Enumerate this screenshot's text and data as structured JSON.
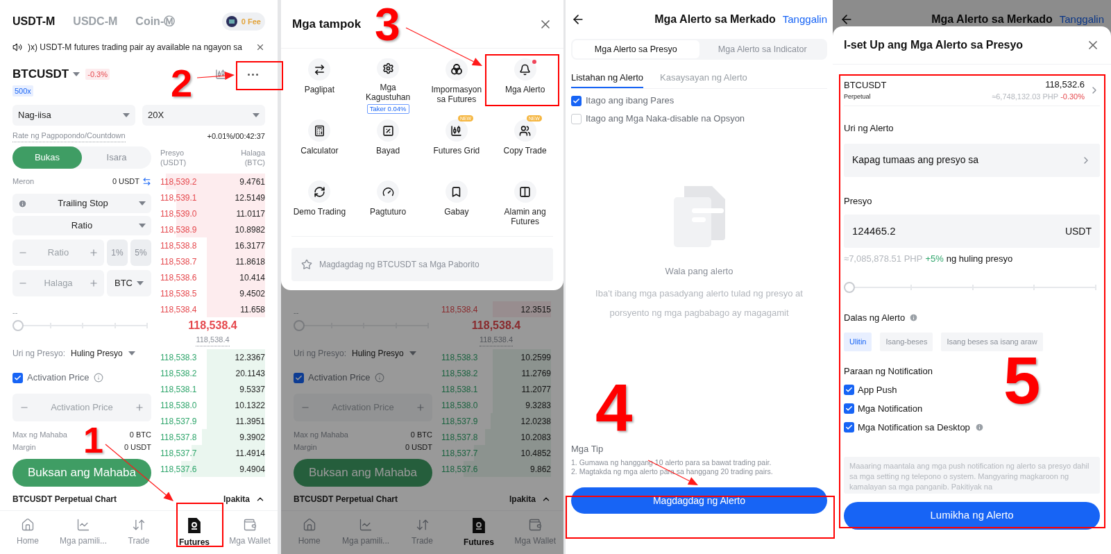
{
  "steps": [
    "1",
    "2",
    "3",
    "4",
    "5"
  ],
  "futures": {
    "market_tabs": [
      {
        "label": "USDT-M",
        "selected": true
      },
      {
        "label": "USDC-M",
        "selected": false
      },
      {
        "label": "Coin-Ⓜ",
        "selected": false
      }
    ],
    "fee_badge": "0 Fee",
    "announcement": ")x) USDT-M futures trading pair ay available na ngayon sa",
    "symbol": "BTCUSDT",
    "change": "-0.3%",
    "leverage_badge": "500x",
    "margin_mode": "Nag-iisa",
    "leverage": "20X",
    "funding_label": "Rate ng Pagpopondo/Countdown",
    "funding_value": "+0.01%/00:42:37",
    "order": {
      "side_tabs": [
        {
          "label": "Bukas",
          "selected": true
        },
        {
          "label": "Isara",
          "selected": false
        }
      ],
      "available_label": "Meron",
      "available_value": "0 USDT",
      "order_type": "Trailing Stop",
      "mode": "Ratio",
      "ratio_placeholder": "Ratio",
      "ratio_presets": [
        "1%",
        "5%"
      ],
      "amount_placeholder": "Halaga",
      "amount_unit": "BTC"
    },
    "lower": {
      "dash": "--",
      "slider": {
        "level": 0
      },
      "price_type_label": "Uri ng Presyo:",
      "price_type": "Huling Presyo",
      "activation": {
        "label": "Activation Price",
        "checked": true,
        "placeholder": "Activation Price"
      },
      "max_label": "Max ng Mahaba",
      "max_value": "0 BTC",
      "margin_label": "Margin",
      "margin_value": "0 USDT",
      "open_button": "Buksan ang Mahaba"
    },
    "book": {
      "price_header": "Presyo (USDT)",
      "amount_header": "Halaga (BTC)",
      "asks": [
        {
          "price": "118,539.2",
          "amount": "9.4761"
        },
        {
          "price": "118,539.1",
          "amount": "12.5149"
        },
        {
          "price": "118,539.0",
          "amount": "11.0117"
        },
        {
          "price": "118,538.9",
          "amount": "10.8982"
        },
        {
          "price": "118,538.8",
          "amount": "16.3177"
        },
        {
          "price": "118,538.7",
          "amount": "11.8618"
        },
        {
          "price": "118,538.6",
          "amount": "10.414"
        },
        {
          "price": "118,538.5",
          "amount": "9.4502"
        },
        {
          "price": "118,538.4",
          "amount": "11.658"
        }
      ],
      "mid_price": "118,538.4",
      "mark_price": "118,538.4",
      "bids": [
        {
          "price": "118,538.3",
          "amount": "12.3367"
        },
        {
          "price": "118,538.2",
          "amount": "20.1143"
        },
        {
          "price": "118,538.1",
          "amount": "9.5337"
        },
        {
          "price": "118,538.0",
          "amount": "10.1322"
        },
        {
          "price": "118,537.9",
          "amount": "11.3951"
        },
        {
          "price": "118,537.8",
          "amount": "9.3902"
        },
        {
          "price": "118,537.7",
          "amount": "11.4914"
        },
        {
          "price": "118,537.6",
          "amount": "9.4904"
        }
      ]
    },
    "chart_bar": {
      "title": "BTCUSDT Perpetual Chart",
      "toggle": "Ipakita"
    },
    "nav": [
      {
        "label": "Home",
        "selected": false
      },
      {
        "label": "Mga pamili...",
        "selected": false
      },
      {
        "label": "Trade",
        "selected": false
      },
      {
        "label": "Futures",
        "selected": true
      },
      {
        "label": "Mga Wallet",
        "selected": false
      }
    ]
  },
  "features_screen": {
    "sheet": {
      "title": "Mga tampok",
      "items": [
        {
          "label": "Paglipat",
          "notification": false
        },
        {
          "label": "Mga Kagustuhan",
          "notification": false,
          "tag": "Taker 0.04%"
        },
        {
          "label": "Impormasyon sa Futures",
          "notification": false
        },
        {
          "label": "Mga Alerto",
          "notification": true
        },
        {
          "label": "Calculator",
          "notification": false
        },
        {
          "label": "Bayad",
          "notification": false
        },
        {
          "label": "Futures Grid",
          "notification": false,
          "badge": "NEW"
        },
        {
          "label": "Copy Trade",
          "notification": false,
          "badge": "NEW"
        },
        {
          "label": "Demo Trading",
          "notification": false
        },
        {
          "label": "Pagtuturo",
          "notification": false
        },
        {
          "label": "Gabay",
          "notification": false
        },
        {
          "label": "Alamin ang Futures",
          "notification": false
        }
      ],
      "favorite": "Magdagdag ng BTCUSDT sa Mga Paborito"
    },
    "background": {
      "lower": {
        "dash": "--",
        "slider": {
          "level": 0
        },
        "price_type_label": "Uri ng Presyo:",
        "price_type": "Huling Presyo",
        "activation": {
          "label": "Activation Price",
          "checked": true,
          "placeholder": "Activation Price"
        },
        "max_label": "Max ng Mahaba",
        "max_value": "0 BTC",
        "margin_label": "Margin",
        "margin_value": "0 USDT",
        "open_button": "Buksan ang Mahaba"
      },
      "book": {
        "asks": [
          {
            "price": "118,538.4",
            "amount": "12.3515"
          }
        ],
        "mid_price": "118,538.4",
        "mark_price": "118,538.4",
        "bids": [
          {
            "price": "118,538.3",
            "amount": "10.2599"
          },
          {
            "price": "118,538.2",
            "amount": "11.2769"
          },
          {
            "price": "118,538.1",
            "amount": "11.2077"
          },
          {
            "price": "118,538.0",
            "amount": "9.3283"
          },
          {
            "price": "118,537.9",
            "amount": "12.0238"
          },
          {
            "price": "118,537.8",
            "amount": "10.2083"
          },
          {
            "price": "118,537.7",
            "amount": "10.4852"
          },
          {
            "price": "118,537.6",
            "amount": "9.862"
          }
        ]
      },
      "chart_bar": {
        "title": "BTCUSDT Perpetual Chart",
        "toggle": "Ipakita"
      },
      "nav": [
        {
          "label": "Home",
          "selected": false
        },
        {
          "label": "Mga pamili...",
          "selected": false
        },
        {
          "label": "Trade",
          "selected": false
        },
        {
          "label": "Futures",
          "selected": true
        },
        {
          "label": "Mga Wallet",
          "selected": false
        }
      ]
    }
  },
  "alerts_screen": {
    "title": "Mga Alerto sa Merkado",
    "action": "Tanggalin",
    "type_tabs": [
      {
        "label": "Mga Alerto sa Presyo",
        "selected": true
      },
      {
        "label": "Mga Alerto sa Indicator",
        "selected": false
      }
    ],
    "list_tabs": [
      {
        "label": "Listahan ng Alerto",
        "selected": true
      },
      {
        "label": "Kasaysayan ng Alerto",
        "selected": false
      }
    ],
    "filters": [
      {
        "label": "Itago ang ibang Pares",
        "checked": true
      },
      {
        "label": "Itago ang Mga Naka-disable na Opsyon",
        "checked": false
      }
    ],
    "empty_title": "Wala pang alerto",
    "empty_text": "Iba't ibang mga pasadyang alerto tulad ng presyo at porsyento ng mga pagbabago ay magagamit",
    "tips_title": "Mga Tip",
    "tips": [
      "1. Gumawa ng hanggang 10 alerto para sa bawat trading pair.",
      "2. Magtakda ng mga alerto para sa hanggang 20 trading pairs."
    ],
    "add_button": "Magdagdag ng Alerto"
  },
  "setup_screen": {
    "background_title": "Mga Alerto sa Merkado",
    "background_action": "Tanggalin",
    "title": "I-set Up ang Mga Alerto sa Presyo",
    "pair": {
      "symbol": "BTCUSDT",
      "type": "Perpetual",
      "price": "118,532.6",
      "converted": "≈6,748,132.03 PHP",
      "change": "-0.30%"
    },
    "alert_type_label": "Uri ng Alerto",
    "alert_type": "Kapag tumaas ang presyo sa",
    "price_label": "Presyo",
    "price_value": "124465.2",
    "price_unit": "USDT",
    "hint_value": "≈7,085,878.51 PHP",
    "hint_change": "+5%",
    "hint_text": "ng huling presyo",
    "slider": {
      "level": 0
    },
    "frequency_label": "Dalas ng Alerto",
    "frequency": [
      {
        "label": "Ulitin",
        "selected": true
      },
      {
        "label": "Isang-beses",
        "selected": false
      },
      {
        "label": "Isang beses sa isang araw",
        "selected": false
      }
    ],
    "methods_label": "Paraan ng Notification",
    "methods": [
      {
        "label": "App Push",
        "checked": true,
        "info": false
      },
      {
        "label": "Mga Notification",
        "checked": true,
        "info": false
      },
      {
        "label": "Mga Notification sa Desktop",
        "checked": true,
        "info": true
      }
    ],
    "note": "Maaaring maantala ang mga push notification ng alerto sa presyo dahil sa mga setting ng telepono o system. Mangyaring magkaroon ng kamalayan sa mga panganib. Pakitiyak na",
    "create_button": "Lumikha ng Alerto"
  }
}
